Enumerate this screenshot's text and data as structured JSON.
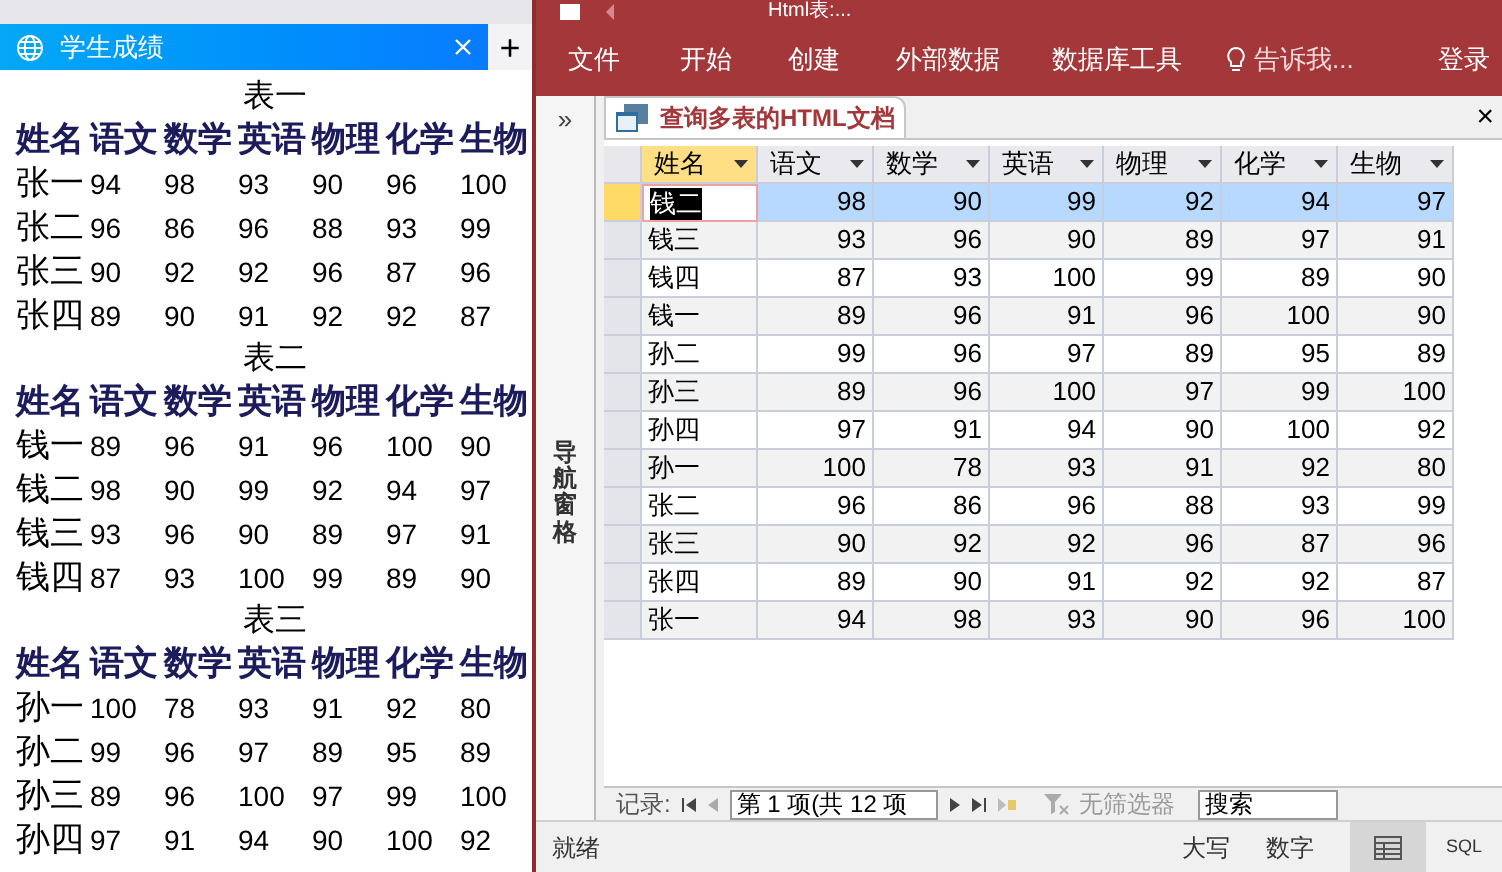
{
  "browser": {
    "tab": {
      "title": "学生成绩",
      "selected": true
    },
    "new_tab": "+",
    "tables": [
      {
        "caption": "表一",
        "columns": [
          "姓名",
          "语文",
          "数学",
          "英语",
          "物理",
          "化学",
          "生物"
        ],
        "rows": [
          [
            "张一",
            "94",
            "98",
            "93",
            "90",
            "96",
            "100"
          ],
          [
            "张二",
            "96",
            "86",
            "96",
            "88",
            "93",
            "99"
          ],
          [
            "张三",
            "90",
            "92",
            "92",
            "96",
            "87",
            "96"
          ],
          [
            "张四",
            "89",
            "90",
            "91",
            "92",
            "92",
            "87"
          ]
        ]
      },
      {
        "caption": "表二",
        "columns": [
          "姓名",
          "语文",
          "数学",
          "英语",
          "物理",
          "化学",
          "生物"
        ],
        "rows": [
          [
            "钱一",
            "89",
            "96",
            "91",
            "96",
            "100",
            "90"
          ],
          [
            "钱二",
            "98",
            "90",
            "99",
            "92",
            "94",
            "97"
          ],
          [
            "钱三",
            "93",
            "96",
            "90",
            "89",
            "97",
            "91"
          ],
          [
            "钱四",
            "87",
            "93",
            "100",
            "99",
            "89",
            "90"
          ]
        ]
      },
      {
        "caption": "表三",
        "columns": [
          "姓名",
          "语文",
          "数学",
          "英语",
          "物理",
          "化学",
          "生物"
        ],
        "rows": [
          [
            "孙一",
            "100",
            "78",
            "93",
            "91",
            "92",
            "80"
          ],
          [
            "孙二",
            "99",
            "96",
            "97",
            "89",
            "95",
            "89"
          ],
          [
            "孙三",
            "89",
            "96",
            "100",
            "97",
            "99",
            "100"
          ],
          [
            "孙四",
            "97",
            "91",
            "94",
            "90",
            "100",
            "92"
          ]
        ]
      }
    ]
  },
  "access": {
    "title": "Html表:...",
    "ribbon_tabs": [
      "文件",
      "开始",
      "创建",
      "外部数据",
      "数据库工具"
    ],
    "tell_me": "告诉我...",
    "sign_in": "登录",
    "nav_pane": {
      "toggle": "»",
      "label": "导航窗格"
    },
    "document_tab": {
      "title": "查询多表的HTML文档",
      "close": "×"
    },
    "columns": [
      {
        "label": "姓名",
        "selected": true
      },
      {
        "label": "语文",
        "selected": false
      },
      {
        "label": "数学",
        "selected": false
      },
      {
        "label": "英语",
        "selected": false
      },
      {
        "label": "物理",
        "selected": false
      },
      {
        "label": "化学",
        "selected": false
      },
      {
        "label": "生物",
        "selected": false
      }
    ],
    "rows": [
      {
        "cells": [
          "钱二",
          "98",
          "90",
          "99",
          "92",
          "94",
          "97"
        ],
        "selected": true
      },
      {
        "cells": [
          "钱三",
          "93",
          "96",
          "90",
          "89",
          "97",
          "91"
        ],
        "selected": false
      },
      {
        "cells": [
          "钱四",
          "87",
          "93",
          "100",
          "99",
          "89",
          "90"
        ],
        "selected": false
      },
      {
        "cells": [
          "钱一",
          "89",
          "96",
          "91",
          "96",
          "100",
          "90"
        ],
        "selected": false
      },
      {
        "cells": [
          "孙二",
          "99",
          "96",
          "97",
          "89",
          "95",
          "89"
        ],
        "selected": false
      },
      {
        "cells": [
          "孙三",
          "89",
          "96",
          "100",
          "97",
          "99",
          "100"
        ],
        "selected": false
      },
      {
        "cells": [
          "孙四",
          "97",
          "91",
          "94",
          "90",
          "100",
          "92"
        ],
        "selected": false
      },
      {
        "cells": [
          "孙一",
          "100",
          "78",
          "93",
          "91",
          "92",
          "80"
        ],
        "selected": false
      },
      {
        "cells": [
          "张二",
          "96",
          "86",
          "96",
          "88",
          "93",
          "99"
        ],
        "selected": false
      },
      {
        "cells": [
          "张三",
          "90",
          "92",
          "92",
          "96",
          "87",
          "96"
        ],
        "selected": false
      },
      {
        "cells": [
          "张四",
          "89",
          "90",
          "91",
          "92",
          "92",
          "87"
        ],
        "selected": false
      },
      {
        "cells": [
          "张一",
          "94",
          "98",
          "93",
          "90",
          "96",
          "100"
        ],
        "selected": false
      }
    ],
    "record_nav": {
      "label": "记录:",
      "position": "第 1 项(共 12 项",
      "filter": "无筛选器",
      "search_placeholder": "搜索"
    },
    "status_bar": {
      "status": "就绪",
      "indicators": [
        "大写",
        "数字"
      ],
      "sql": "SQL"
    }
  }
}
